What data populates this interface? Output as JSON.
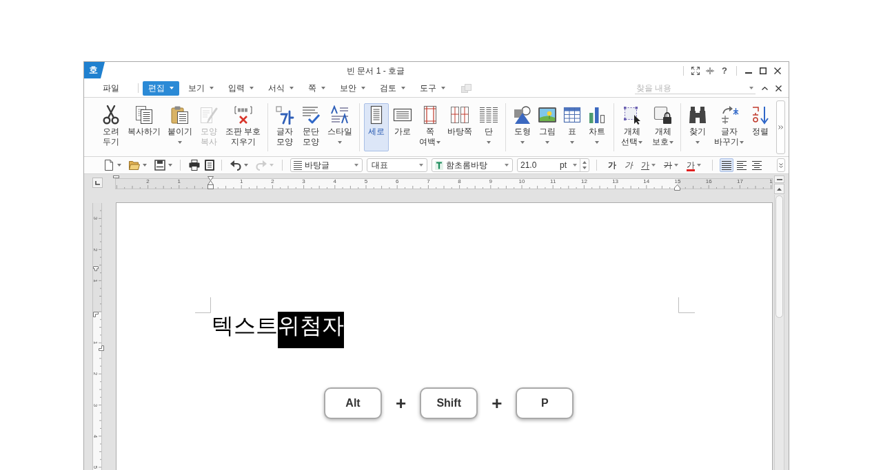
{
  "window": {
    "logo": "호",
    "title": "빈 문서 1 - 호글",
    "help": "?"
  },
  "menu_bar": {
    "items": [
      {
        "label": "파일",
        "dropdown": false,
        "selected": false
      },
      {
        "label": "편집",
        "dropdown": true,
        "selected": true
      },
      {
        "label": "보기",
        "dropdown": true,
        "selected": false
      },
      {
        "label": "입력",
        "dropdown": true,
        "selected": false
      },
      {
        "label": "서식",
        "dropdown": true,
        "selected": false
      },
      {
        "label": "쪽",
        "dropdown": true,
        "selected": false
      },
      {
        "label": "보안",
        "dropdown": true,
        "selected": false
      },
      {
        "label": "검토",
        "dropdown": true,
        "selected": false
      },
      {
        "label": "도구",
        "dropdown": true,
        "selected": false
      }
    ],
    "search": {
      "placeholder": "찾을 내용"
    }
  },
  "ribbon": {
    "groups": [
      [
        {
          "label": "오려\n두기",
          "dropdown": false,
          "disabled": false,
          "selected": false
        },
        {
          "label": "복사하기",
          "dropdown": false,
          "disabled": false,
          "selected": false
        },
        {
          "label": "붙이기",
          "dropdown": true,
          "disabled": false,
          "selected": false
        },
        {
          "label": "모양\n복사",
          "dropdown": false,
          "disabled": true,
          "selected": false
        },
        {
          "label": "조판 부호\n지우기",
          "dropdown": false,
          "disabled": false,
          "selected": false
        }
      ],
      [
        {
          "label": "글자\n모양",
          "dropdown": false,
          "disabled": false,
          "selected": false
        },
        {
          "label": "문단\n모양",
          "dropdown": false,
          "disabled": false,
          "selected": false
        },
        {
          "label": "스타일",
          "dropdown": true,
          "disabled": false,
          "selected": false
        }
      ],
      [
        {
          "label": "세로",
          "dropdown": false,
          "disabled": false,
          "selected": true
        },
        {
          "label": "가로",
          "dropdown": false,
          "disabled": false,
          "selected": false
        },
        {
          "label": "쪽\n여백",
          "dropdown": true,
          "disabled": false,
          "selected": false
        },
        {
          "label": "바탕쪽",
          "dropdown": false,
          "disabled": false,
          "selected": false
        },
        {
          "label": "단",
          "dropdown": true,
          "disabled": false,
          "selected": false
        }
      ],
      [
        {
          "label": "도형",
          "dropdown": true,
          "disabled": false,
          "selected": false
        },
        {
          "label": "그림",
          "dropdown": true,
          "disabled": false,
          "selected": false
        },
        {
          "label": "표",
          "dropdown": true,
          "disabled": false,
          "selected": false
        },
        {
          "label": "차트",
          "dropdown": true,
          "disabled": false,
          "selected": false
        }
      ],
      [
        {
          "label": "개체\n선택",
          "dropdown": true,
          "disabled": false,
          "selected": false
        },
        {
          "label": "개체\n보호",
          "dropdown": true,
          "disabled": false,
          "selected": false
        }
      ],
      [
        {
          "label": "찾기",
          "dropdown": true,
          "disabled": false,
          "selected": false
        },
        {
          "label": "글자\n바꾸기",
          "dropdown": true,
          "disabled": false,
          "selected": false
        },
        {
          "label": "정렬",
          "dropdown": false,
          "disabled": false,
          "selected": false
        }
      ]
    ]
  },
  "toolbar": {
    "groups": [
      [
        {
          "kind": "icon",
          "dropdown": true,
          "disabled": false
        },
        {
          "kind": "icon",
          "dropdown": true,
          "disabled": false
        },
        {
          "kind": "icon",
          "dropdown": true,
          "disabled": false
        }
      ],
      [
        {
          "kind": "icon",
          "dropdown": false,
          "disabled": false
        },
        {
          "kind": "icon",
          "dropdown": false,
          "disabled": false
        }
      ],
      [
        {
          "kind": "icon",
          "dropdown": true,
          "disabled": false
        },
        {
          "kind": "icon",
          "dropdown": true,
          "disabled": true
        }
      ],
      [
        {
          "kind": "combo",
          "value": "바탕글"
        },
        {
          "kind": "combo",
          "value": "대표"
        },
        {
          "kind": "combo",
          "value": "함초롬바탕"
        },
        {
          "kind": "spin",
          "value": "21.0",
          "unit": "pt"
        }
      ],
      [
        {
          "kind": "bold",
          "label": "가",
          "dropdown": false
        },
        {
          "kind": "italic",
          "label": "가",
          "dropdown": false
        },
        {
          "kind": "underline",
          "label": "가",
          "dropdown": true
        },
        {
          "kind": "strike",
          "label": "가",
          "dropdown": true
        },
        {
          "kind": "color",
          "label": "가",
          "dropdown": true
        }
      ],
      [
        {
          "kind": "align",
          "selected": true
        },
        {
          "kind": "align",
          "selected": false
        },
        {
          "kind": "align",
          "selected": false
        }
      ]
    ]
  },
  "ruler": {
    "labels": [
      "2",
      "1",
      "1",
      "2",
      "3",
      "4",
      "5",
      "6",
      "7",
      "8",
      "9",
      "10",
      "11",
      "12",
      "13",
      "14",
      "15",
      "16",
      "17",
      "1"
    ]
  },
  "vertical_ruler": {
    "labels": [
      "3",
      "2",
      "1",
      "1",
      "2",
      "3",
      "4",
      "5"
    ]
  },
  "document": {
    "paragraphs": [
      {
        "runs": [
          {
            "text": "텍스트",
            "selected": false
          },
          {
            "text": "위첨자",
            "selected": true
          }
        ]
      }
    ]
  },
  "shortcut": [
    {
      "kind": "key",
      "label": "Alt"
    },
    {
      "kind": "plus",
      "label": "+"
    },
    {
      "kind": "key",
      "label": "Shift"
    },
    {
      "kind": "plus",
      "label": "+"
    },
    {
      "kind": "key",
      "label": "P"
    }
  ]
}
